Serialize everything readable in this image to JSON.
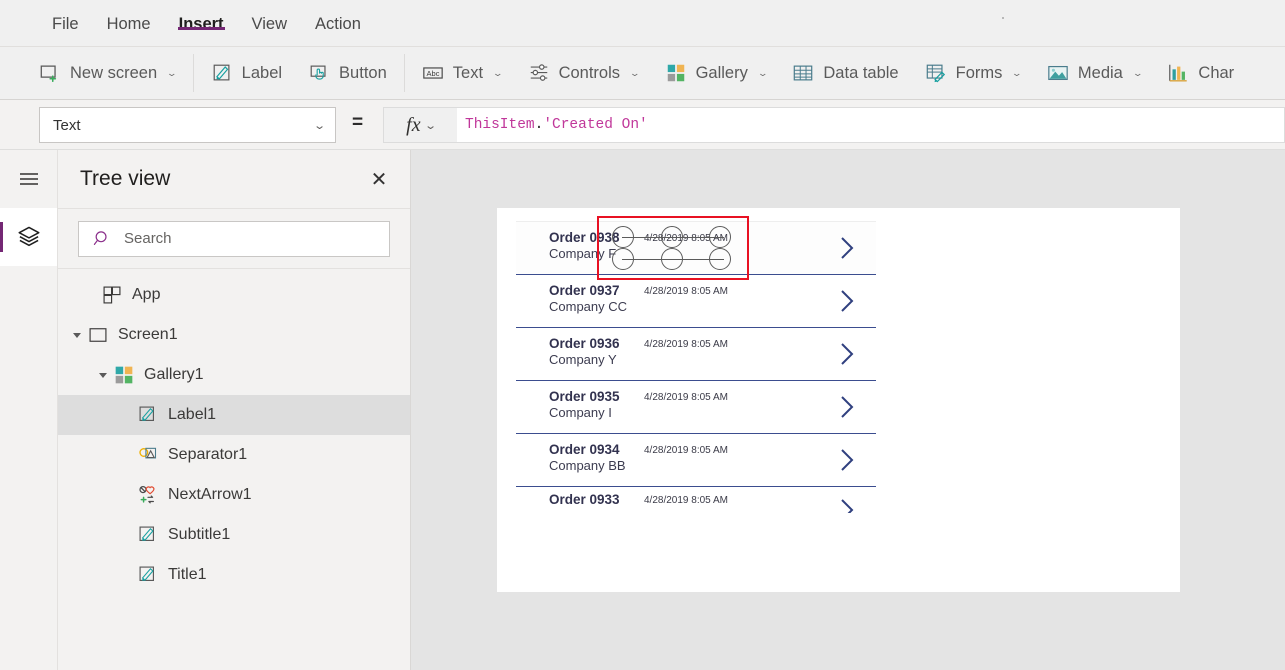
{
  "menubar": {
    "items": [
      {
        "label": "File",
        "active": false
      },
      {
        "label": "Home",
        "active": false
      },
      {
        "label": "Insert",
        "active": true
      },
      {
        "label": "View",
        "active": false
      },
      {
        "label": "Action",
        "active": false
      }
    ]
  },
  "ribbon": {
    "items": [
      {
        "label": "New screen",
        "icon": "new-screen-icon",
        "caret": "⌄"
      },
      {
        "label": "Label",
        "icon": "label-icon",
        "caret": ""
      },
      {
        "label": "Button",
        "icon": "button-icon",
        "caret": ""
      },
      {
        "label": "Text",
        "icon": "text-abc-icon",
        "caret": "⌄"
      },
      {
        "label": "Controls",
        "icon": "controls-sliders-icon",
        "caret": "⌄"
      },
      {
        "label": "Gallery",
        "icon": "gallery-icon",
        "caret": "⌄"
      },
      {
        "label": "Data table",
        "icon": "data-table-icon",
        "caret": ""
      },
      {
        "label": "Forms",
        "icon": "forms-icon",
        "caret": "⌄"
      },
      {
        "label": "Media",
        "icon": "media-icon",
        "caret": "⌄"
      },
      {
        "label": "Char",
        "icon": "charts-icon",
        "caret": ""
      }
    ]
  },
  "formula_bar": {
    "property_selected": "Text",
    "equals": "=",
    "fx_label": "fx",
    "fx_caret": "⌄",
    "formula_identifier": "ThisItem",
    "formula_dot": ".",
    "formula_string": "'Created On'",
    "formula_full": "ThisItem.'Created On'",
    "syntax_color": "#c0379a"
  },
  "rail": {
    "hamburger": "hamburger-menu-icon",
    "active_item": "tree-view-layers-icon",
    "accent_color": "#742774"
  },
  "tree_view": {
    "title": "Tree view",
    "close_label": "✕",
    "search_placeholder": "Search",
    "search_value": "",
    "items": [
      {
        "label": "App",
        "indent": 0,
        "caret": false,
        "expanded": false,
        "icon": "app-icon",
        "selected": false
      },
      {
        "label": "Screen1",
        "indent": 1,
        "caret": true,
        "expanded": true,
        "icon": "screen-icon",
        "selected": false
      },
      {
        "label": "Gallery1",
        "indent": 2,
        "caret": true,
        "expanded": true,
        "icon": "gallery-icon",
        "selected": false
      },
      {
        "label": "Label1",
        "indent": 3,
        "caret": false,
        "expanded": false,
        "icon": "label-icon",
        "selected": true
      },
      {
        "label": "Separator1",
        "indent": 3,
        "caret": false,
        "expanded": false,
        "icon": "separator-icon",
        "selected": false
      },
      {
        "label": "NextArrow1",
        "indent": 3,
        "caret": false,
        "expanded": false,
        "icon": "next-arrow-icon",
        "selected": false
      },
      {
        "label": "Subtitle1",
        "indent": 3,
        "caret": false,
        "expanded": false,
        "icon": "label-icon",
        "selected": false
      },
      {
        "label": "Title1",
        "indent": 3,
        "caret": false,
        "expanded": false,
        "icon": "label-icon",
        "selected": false
      }
    ]
  },
  "canvas": {
    "selected_control": "Label1",
    "selection_border_color": "#e81123",
    "gallery_rows": [
      {
        "title": "Order 0938",
        "subtitle": "Company F",
        "date": "4/28/2019 8:05 AM",
        "chevron": "chevron-right-icon",
        "selected_row": true,
        "clipped": false
      },
      {
        "title": "Order 0937",
        "subtitle": "Company CC",
        "date": "4/28/2019 8:05 AM",
        "chevron": "chevron-right-icon",
        "selected_row": false,
        "clipped": false
      },
      {
        "title": "Order 0936",
        "subtitle": "Company Y",
        "date": "4/28/2019 8:05 AM",
        "chevron": "chevron-right-icon",
        "selected_row": false,
        "clipped": false
      },
      {
        "title": "Order 0935",
        "subtitle": "Company I",
        "date": "4/28/2019 8:05 AM",
        "chevron": "chevron-right-icon",
        "selected_row": false,
        "clipped": false
      },
      {
        "title": "Order 0934",
        "subtitle": "Company BB",
        "date": "4/28/2019 8:05 AM",
        "chevron": "chevron-right-icon",
        "selected_row": false,
        "clipped": false
      },
      {
        "title": "Order 0933",
        "subtitle": "",
        "date": "4/28/2019 8:05 AM",
        "chevron": "chevron-right-icon",
        "selected_row": false,
        "clipped": true
      }
    ]
  }
}
